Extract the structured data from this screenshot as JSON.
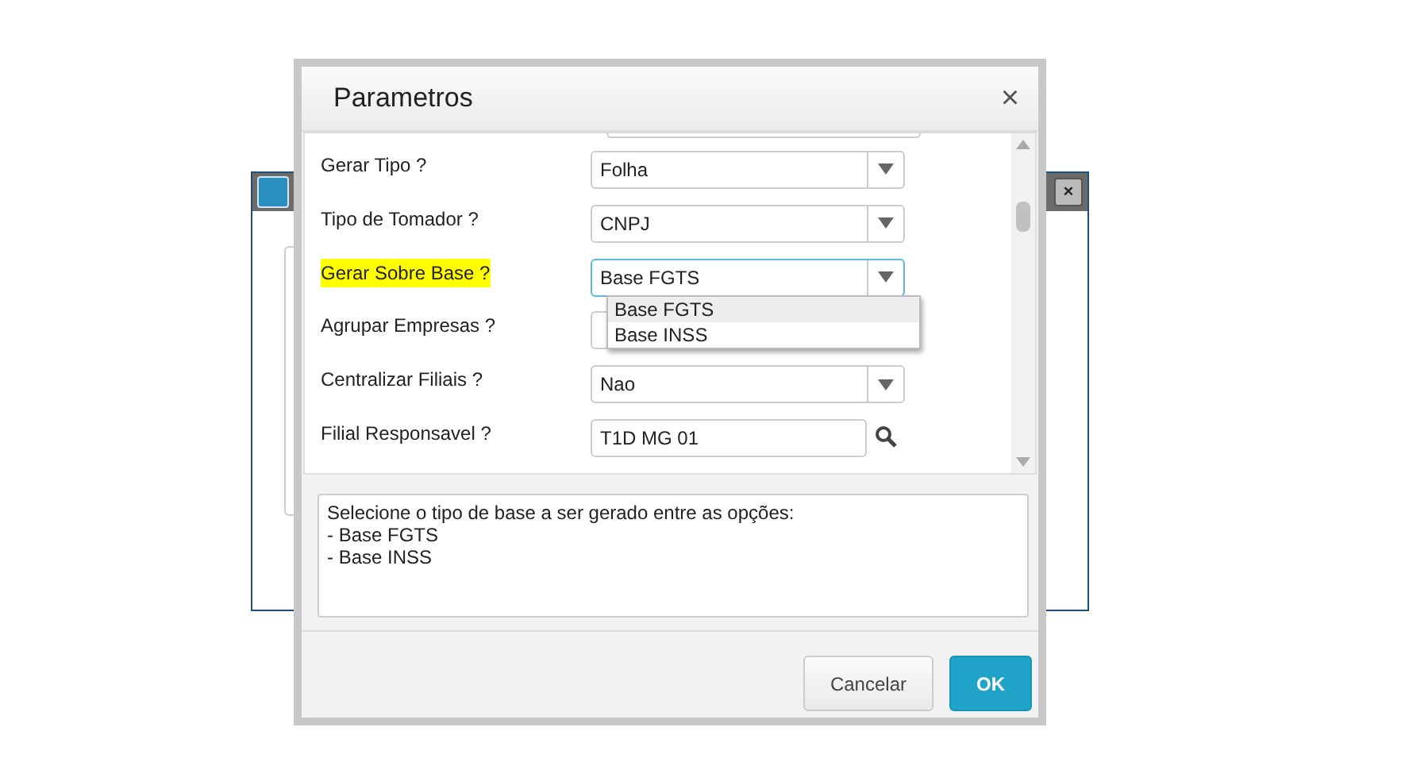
{
  "background_window": {
    "close": "×"
  },
  "dialog": {
    "title": "Parametros",
    "close": "×"
  },
  "fields": [
    {
      "label": "Gerar Tipo ?",
      "kind": "select",
      "value": "Folha",
      "highlighted": false
    },
    {
      "label": "Tipo de Tomador ?",
      "kind": "select",
      "value": "CNPJ",
      "highlighted": false
    },
    {
      "label": "Gerar Sobre Base ?",
      "kind": "select",
      "value": "Base FGTS",
      "highlighted": true,
      "open": true,
      "options": [
        {
          "label": "Base FGTS",
          "selected": true
        },
        {
          "label": "Base INSS",
          "selected": false
        }
      ]
    },
    {
      "label": "Agrupar Empresas ?",
      "kind": "select",
      "highlighted": false
    },
    {
      "label": "Centralizar Filiais ?",
      "kind": "select",
      "value": "Nao",
      "highlighted": false
    },
    {
      "label": "Filial Responsavel ?",
      "kind": "lookup",
      "value": "T1D MG 01",
      "highlighted": false
    }
  ],
  "help": [
    "Selecione o tipo de base a ser gerado entre as opções:",
    "- Base FGTS",
    "- Base INSS"
  ],
  "buttons": [
    {
      "label": "Cancelar",
      "kind": "secondary"
    },
    {
      "label": "OK",
      "kind": "primary"
    }
  ]
}
